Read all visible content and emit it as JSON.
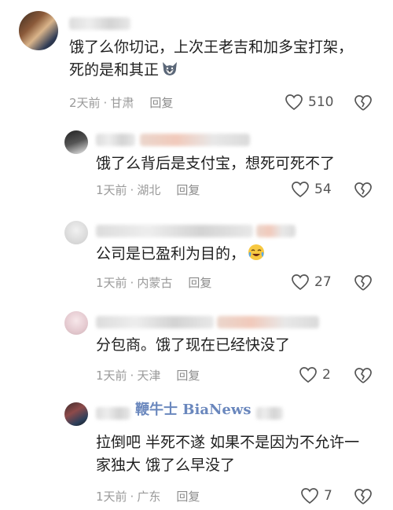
{
  "comments": [
    {
      "text": "饿了么你切记，上次王老吉和加多宝打架，死的是和其正",
      "emoji": "wolf-emoji",
      "time": "2天前",
      "location": "甘肃",
      "reply_label": "回复",
      "likes": "510"
    },
    {
      "text": "饿了么背后是支付宝，想死可死不了",
      "time": "1天前",
      "location": "湖北",
      "reply_label": "回复",
      "likes": "54"
    },
    {
      "text": "公司是已盈利为目的，",
      "emoji": "crying-laugh-emoji",
      "time": "1天前",
      "location": "内蒙古",
      "reply_label": "回复",
      "likes": "27"
    },
    {
      "text": "分包商。饿了现在已经快没了",
      "time": "1天前",
      "location": "天津",
      "reply_label": "回复",
      "likes": "2"
    },
    {
      "text": "拉倒吧 半死不遂 如果不是因为不允许一家独大 饿了么早没了",
      "time": "1天前",
      "location": "广东",
      "reply_label": "回复",
      "likes": "7"
    }
  ],
  "watermark": "鞭牛士 BiaNews",
  "colors": {
    "text": "#1f1f1f",
    "meta": "#9a9a9a",
    "icon": "#555555",
    "watermark": "#5a7bb6"
  }
}
